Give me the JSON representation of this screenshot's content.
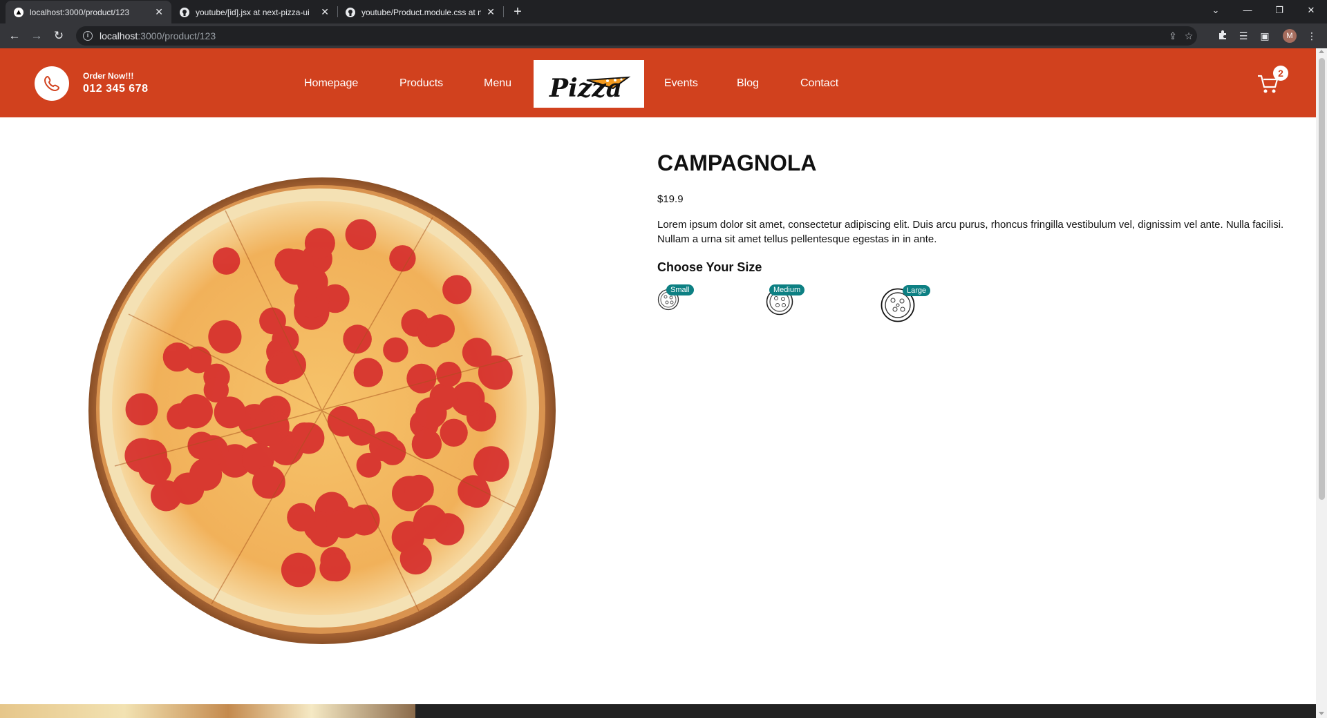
{
  "browser": {
    "tabs": [
      {
        "title": "localhost:3000/product/123",
        "active": true
      },
      {
        "title": "youtube/[id].jsx at next-pizza-ui",
        "active": false
      },
      {
        "title": "youtube/Product.module.css at n",
        "active": false
      }
    ],
    "url_host": "localhost",
    "url_path": ":3000/product/123",
    "profile_initial": "M"
  },
  "site": {
    "order_label": "Order Now!!!",
    "order_phone": "012 345 678",
    "nav": [
      "Homepage",
      "Products",
      "Menu",
      "Events",
      "Blog",
      "Contact"
    ],
    "logo_text": "Pizza",
    "cart_count": "2",
    "brand_color": "#d1411e",
    "badge_color": "#0d8083"
  },
  "product": {
    "name": "CAMPAGNOLA",
    "price": "$19.9",
    "description": "Lorem ipsum dolor sit amet, consectetur adipiscing elit. Duis arcu purus, rhoncus fringilla vestibulum vel, dignissim vel ante. Nulla facilisi. Nullam a urna sit amet tellus pellentesque egestas in in ante.",
    "size_heading": "Choose Your Size",
    "sizes": [
      "Small",
      "Medium",
      "Large"
    ]
  }
}
